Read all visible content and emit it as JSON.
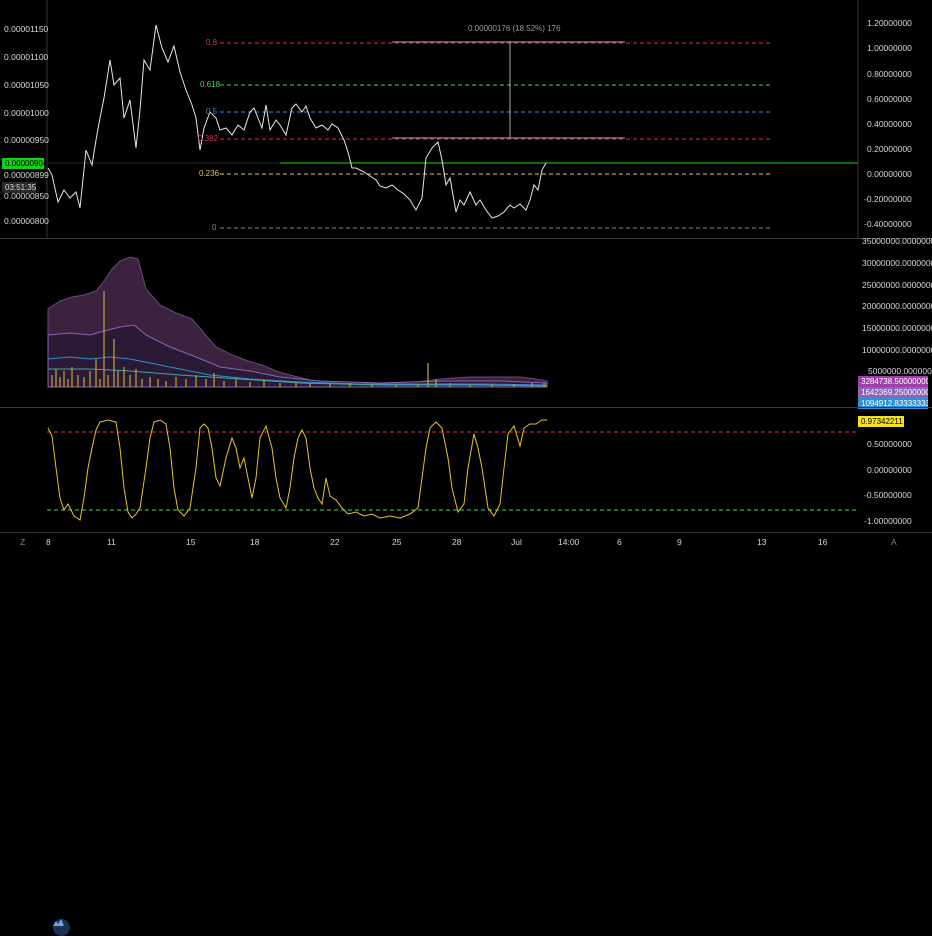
{
  "price_axis": {
    "left_labels": [
      "0.00001150",
      "0.00001100",
      "0.00001050",
      "0.00001000",
      "0.00000950",
      "0.00000899",
      "0.00000850",
      "0.00000800"
    ],
    "current_price": "0.00000904",
    "countdown": "03:51:35"
  },
  "fib": {
    "measure_label": "0.00000176 (18.52%) 176",
    "levels": [
      {
        "label": "0.8",
        "color": "#e0304a"
      },
      {
        "label": "0.618",
        "color": "#4cd64c"
      },
      {
        "label": "0.5",
        "color": "#3a8ee6"
      },
      {
        "label": "0.382",
        "color": "#e0304a"
      },
      {
        "label": "0.236",
        "color": "#e6c34a"
      },
      {
        "label": "0",
        "color": "#888888"
      }
    ],
    "right_labels": [
      "1.20000000",
      "1.00000000",
      "0.80000000",
      "0.60000000",
      "0.40000000",
      "0.20000000",
      "0.00000000",
      "-0.20000000",
      "-0.40000000"
    ]
  },
  "volume_pane": {
    "right_labels": [
      "35000000.00000000",
      "30000000.00000000",
      "25000000.00000000",
      "20000000.00000000",
      "15000000.00000000",
      "10000000.00000000",
      "5000000.00000000"
    ],
    "badges": [
      {
        "text": "3284738.50000000",
        "color": "#9c3fa8"
      },
      {
        "text": "1642369.25000000",
        "color": "#8e63b8"
      },
      {
        "text": "1094912.83333333",
        "color": "#2f8fd6"
      }
    ]
  },
  "oscillator_pane": {
    "badge": {
      "text": "0.97342211",
      "color": "#f5e11a"
    },
    "right_labels": [
      "0.50000000",
      "0.00000000",
      "-0.50000000",
      "-1.00000000"
    ]
  },
  "time_axis": {
    "labels": [
      "8",
      "11",
      "15",
      "18",
      "22",
      "25",
      "28",
      "Jul",
      "14:00",
      "6",
      "9",
      "13",
      "16"
    ],
    "corner_left": "Z",
    "corner_right": "A"
  },
  "colors": {
    "price_line": "#e6e6e6",
    "current_price_line": "#12d312",
    "oscillator_line": "#e6c32a",
    "volume_band": "#4a2a5a"
  }
}
